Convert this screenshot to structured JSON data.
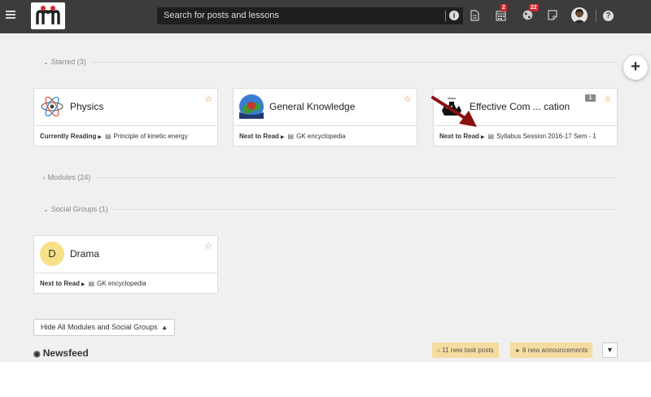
{
  "topbar": {
    "search_placeholder": "Search for posts and lessons",
    "calendar_badge": "2",
    "globe_badge": "22",
    "help_label": "?",
    "info_label": "i"
  },
  "fab_label": "+",
  "sections": {
    "starred": "Starred (3)",
    "modules": "Modules (24)",
    "social_groups": "Social Groups (1)"
  },
  "starred_cards": [
    {
      "title": "Physics",
      "status": "Currently Reading",
      "item": "Principle of kinetic energy"
    },
    {
      "title": "General Knowledge",
      "status": "Next to Read",
      "item": "GK encyclopedia"
    },
    {
      "title": "Effective Com ... cation",
      "status": "Next to Read",
      "item": "Syllabus Session 2016-17 Sem - 1",
      "count": "1"
    }
  ],
  "social_cards": [
    {
      "title": "Drama",
      "initial": "D",
      "status": "Next to Read",
      "item": "GK encyclopedia"
    }
  ],
  "hide_button": "Hide All Modules and Social Groups",
  "newsfeed": {
    "title": "Newsfeed",
    "task_posts": "11 new task posts",
    "announcements": "8 new announcements"
  },
  "colors": {
    "topbar": "#3c3c3c",
    "brand_red": "#d9232d",
    "star": "#e67e22",
    "pill": "#f5dca0",
    "arrow": "#8b1010"
  }
}
